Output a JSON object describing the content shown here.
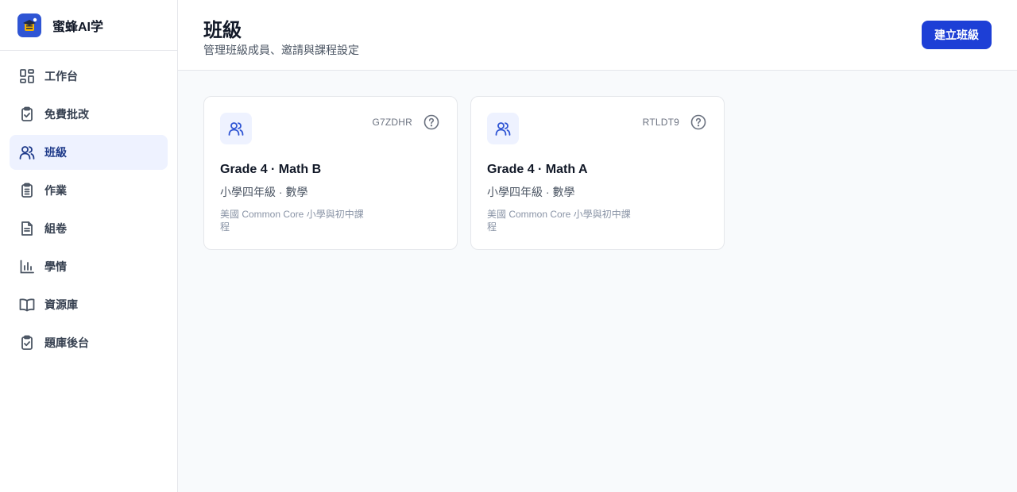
{
  "app": {
    "name": "蜜蜂AI学"
  },
  "sidebar": {
    "items": [
      {
        "label": "工作台",
        "icon": "dashboard-icon",
        "active": false
      },
      {
        "label": "免費批改",
        "icon": "clipboard-check-icon",
        "active": false
      },
      {
        "label": "班級",
        "icon": "users-icon",
        "active": true
      },
      {
        "label": "作業",
        "icon": "clipboard-list-icon",
        "active": false
      },
      {
        "label": "組卷",
        "icon": "document-icon",
        "active": false
      },
      {
        "label": "學情",
        "icon": "bar-chart-icon",
        "active": false
      },
      {
        "label": "資源庫",
        "icon": "book-open-icon",
        "active": false
      },
      {
        "label": "題庫後台",
        "icon": "clipboard-check-icon",
        "active": false
      }
    ]
  },
  "header": {
    "title": "班級",
    "subtitle": "管理班級成員、邀請與課程設定",
    "create_button": "建立班級"
  },
  "classes": [
    {
      "code": "G7ZDHR",
      "title": "Grade 4 · Math B",
      "grade": "小學四年級 · 數學",
      "curriculum": "美國 Common Core 小學與初中課程"
    },
    {
      "code": "RTLDT9",
      "title": "Grade 4 · Math A",
      "grade": "小學四年級 · 數學",
      "curriculum": "美國 Common Core 小學與初中課程"
    }
  ],
  "colors": {
    "primary": "#1d3fd6",
    "active_bg": "#eef2ff",
    "active_text": "#1e3a8a",
    "page_bg": "#f8fafc"
  }
}
